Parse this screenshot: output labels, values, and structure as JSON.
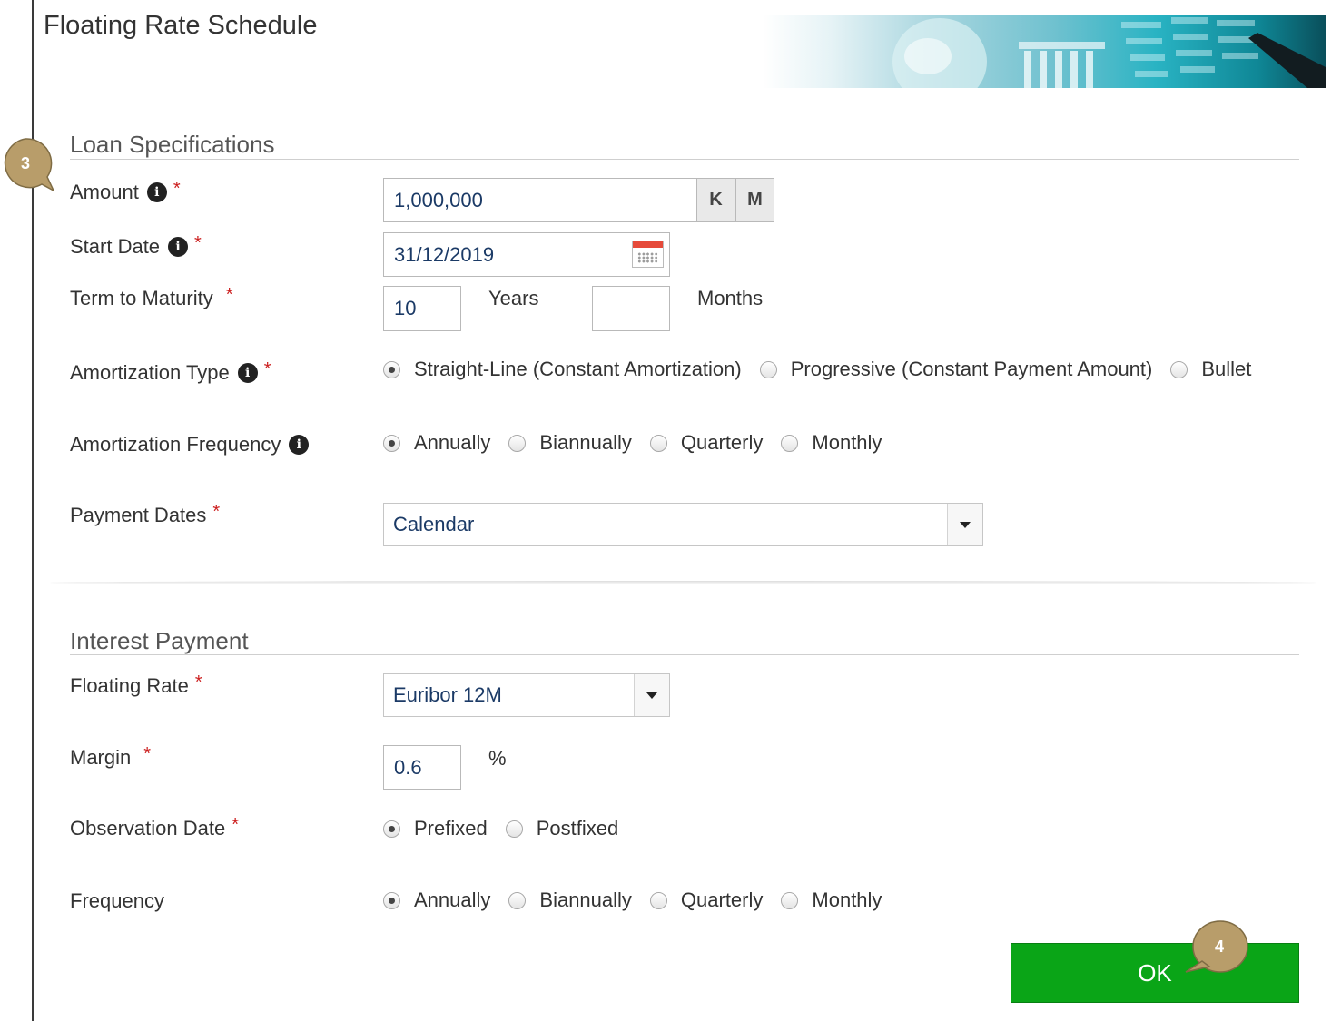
{
  "page": {
    "title": "Floating Rate Schedule"
  },
  "loan_section": {
    "title": "Loan Specifications",
    "amount": {
      "label": "Amount",
      "value": "1,000,000",
      "unit_k": "K",
      "unit_m": "M"
    },
    "start_date": {
      "label": "Start Date",
      "value": "31/12/2019"
    },
    "term": {
      "label": "Term to Maturity",
      "years_value": "10",
      "years_label": "Years",
      "months_value": "",
      "months_label": "Months"
    },
    "amortization_type": {
      "label": "Amortization Type",
      "options": [
        "Straight-Line (Constant Amortization)",
        "Progressive (Constant Payment Amount)",
        "Bullet"
      ],
      "selected": "Straight-Line (Constant Amortization)"
    },
    "amortization_frequency": {
      "label": "Amortization Frequency",
      "options": [
        "Annually",
        "Biannually",
        "Quarterly",
        "Monthly"
      ],
      "selected": "Annually"
    },
    "payment_dates": {
      "label": "Payment Dates",
      "value": "Calendar"
    }
  },
  "interest_section": {
    "title": "Interest Payment",
    "floating_rate": {
      "label": "Floating Rate",
      "value": "Euribor 12M"
    },
    "margin": {
      "label": "Margin",
      "value": "0.6",
      "unit": "%"
    },
    "observation_date": {
      "label": "Observation Date",
      "options": [
        "Prefixed",
        "Postfixed"
      ],
      "selected": "Prefixed"
    },
    "frequency": {
      "label": "Frequency",
      "options": [
        "Annually",
        "Biannually",
        "Quarterly",
        "Monthly"
      ],
      "selected": "Annually"
    }
  },
  "actions": {
    "ok_label": "OK"
  },
  "callouts": [
    "3",
    "4"
  ],
  "icons": {
    "info": "info-icon",
    "calendar": "calendar-icon",
    "dropdown": "chevron-down-icon"
  },
  "colors": {
    "ok_button": "#0aa517",
    "callout": "#b89d6a",
    "required": "#cc1f1f",
    "input_text": "#1b3a66"
  }
}
